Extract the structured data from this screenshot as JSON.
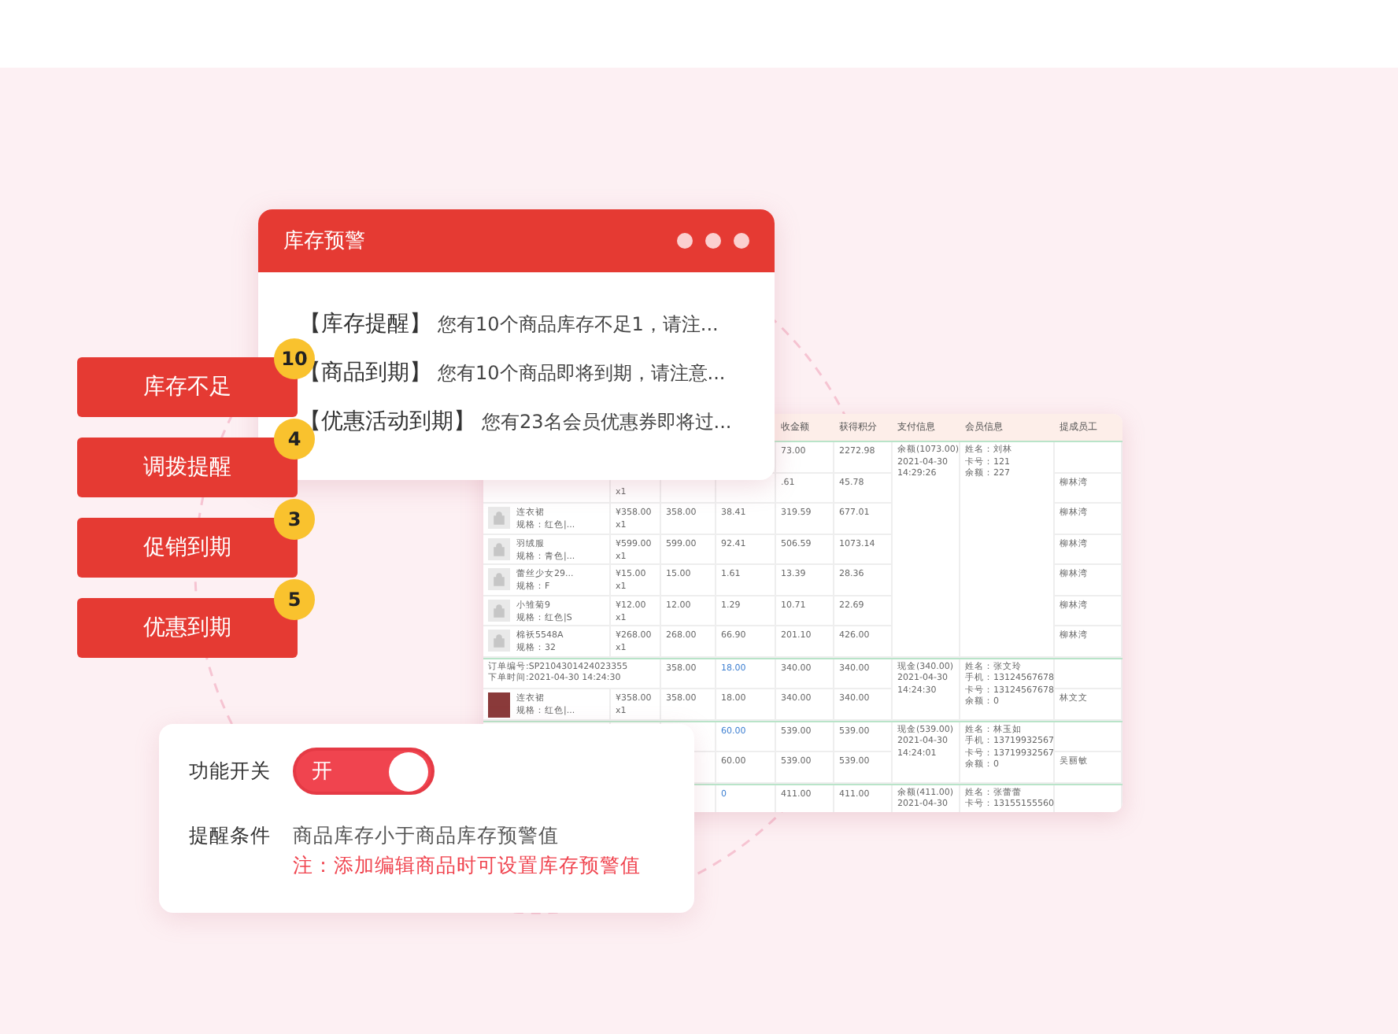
{
  "alert_window": {
    "title": "库存预警",
    "messages": [
      {
        "tag": "【库存提醒】",
        "text": "您有10个商品库存不足1，请注..."
      },
      {
        "tag": "【商品到期】",
        "text": "您有10个商品即将到期，请注意..."
      },
      {
        "tag": "【优惠活动到期】",
        "text": "您有23名会员优惠券即将过..."
      }
    ]
  },
  "reminder_buttons": [
    {
      "label": "库存不足",
      "count": "10"
    },
    {
      "label": "调拨提醒",
      "count": "4"
    },
    {
      "label": "促销到期",
      "count": "3"
    },
    {
      "label": "优惠到期",
      "count": "5"
    }
  ],
  "orders_table": {
    "columns": [
      "收金额",
      "获得积分",
      "支付信息",
      "会员信息",
      "提成员工"
    ],
    "groups": [
      {
        "payment": [
          "余额(1073.00)",
          "2021-04-30",
          "14:29:26"
        ],
        "member": [
          "姓名：刘林",
          "卡号：121",
          "余额：227"
        ],
        "rows": [
          {
            "kind": "partial",
            "c5": "73.00",
            "points": "2272.98"
          },
          {
            "kind": "partial",
            "qty": "x1",
            "c5": ".61",
            "points": "45.78",
            "staff": "柳林湾"
          },
          {
            "kind": "product",
            "name": "连衣裙",
            "spec": "规格：红色|...",
            "price": "¥358.00",
            "qty": "x1",
            "c3": "358.00",
            "c4": "38.41",
            "c4_link": false,
            "c5": "319.59",
            "points": "677.01",
            "staff": "柳林湾"
          },
          {
            "kind": "product",
            "name": "羽绒服",
            "spec": "规格：青色|...",
            "price": "¥599.00",
            "qty": "x1",
            "c3": "599.00",
            "c4": "92.41",
            "c4_link": false,
            "c5": "506.59",
            "points": "1073.14",
            "staff": "柳林湾"
          },
          {
            "kind": "product",
            "name": "蕾丝少女29...",
            "spec": "规格：F",
            "price": "¥15.00",
            "qty": "x1",
            "c3": "15.00",
            "c4": "1.61",
            "c4_link": false,
            "c5": "13.39",
            "points": "28.36",
            "staff": "柳林湾"
          },
          {
            "kind": "product",
            "name": "小雏菊9",
            "spec": "规格：红色|S",
            "price": "¥12.00",
            "qty": "x1",
            "c3": "12.00",
            "c4": "1.29",
            "c4_link": false,
            "c5": "10.71",
            "points": "22.69",
            "staff": "柳林湾"
          },
          {
            "kind": "product",
            "name": "棉袄5548A",
            "spec": "规格：32",
            "price": "¥268.00",
            "qty": "x1",
            "c3": "268.00",
            "c4": "66.90",
            "c4_link": false,
            "c5": "201.10",
            "points": "426.00",
            "staff": "柳林湾"
          }
        ]
      },
      {
        "payment": [
          "现金(340.00)",
          "2021-04-30",
          "14:24:30"
        ],
        "member": [
          "姓名：张文玲",
          "手机：13124567678",
          "卡号：13124567678",
          "余额：0"
        ],
        "rows": [
          {
            "kind": "order",
            "order_no": "订单编号:SP2104301424023355",
            "order_time": "下单时间:2021-04-30 14:24:30",
            "c3": "358.00",
            "c4": "18.00",
            "c4_link": true,
            "c5": "340.00",
            "points": "340.00"
          },
          {
            "kind": "photo_product",
            "name": "连衣裙",
            "spec": "规格：红色|...",
            "price": "¥358.00",
            "qty": "x1",
            "c3": "358.00",
            "c4": "18.00",
            "c4_link": false,
            "c5": "340.00",
            "points": "340.00",
            "staff": "林文文"
          }
        ]
      },
      {
        "payment": [
          "现金(539.00)",
          "2021-04-30",
          "14:24:01"
        ],
        "member": [
          "姓名：林玉如",
          "手机：13719932567",
          "卡号：13719932567",
          "余额：0"
        ],
        "rows": [
          {
            "kind": "partial",
            "c4": "60.00",
            "c4_link": true,
            "c5": "539.00",
            "points": "539.00"
          },
          {
            "kind": "partial",
            "c4": "60.00",
            "c4_link": false,
            "c5": "539.00",
            "points": "539.00",
            "staff": "吴丽敏"
          }
        ]
      },
      {
        "payment": [
          "余额(411.00)",
          "2021-04-30"
        ],
        "member": [
          "姓名：张蕾蕾",
          "卡号：13155155560"
        ],
        "rows": [
          {
            "kind": "partial",
            "c4": "0",
            "c4_link": true,
            "c5": "411.00",
            "points": "411.00"
          }
        ]
      }
    ]
  },
  "settings_card": {
    "switch_label": "功能开关",
    "switch": {
      "on": true,
      "text": "开"
    },
    "condition_label": "提醒条件",
    "condition": "商品库存小于商品库存预警值",
    "note": "注：添加编辑商品时可设置库存预警值"
  }
}
